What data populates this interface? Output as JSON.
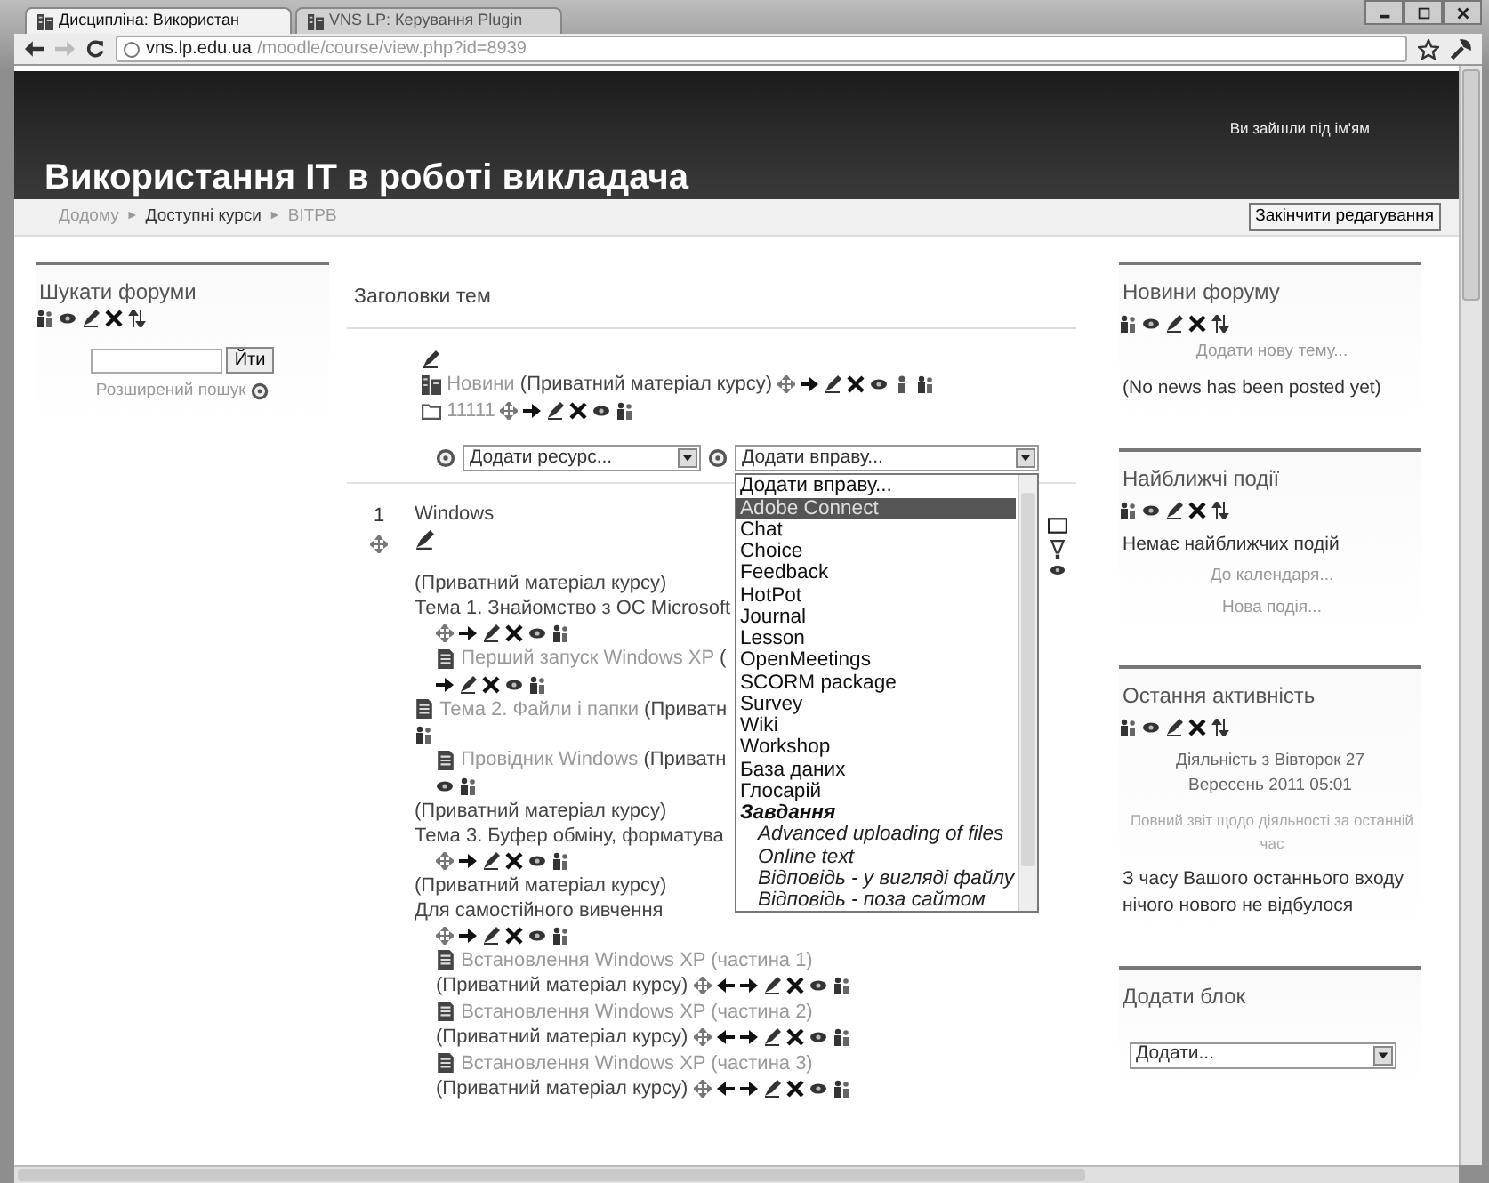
{
  "browser": {
    "tabs": [
      {
        "label": "Дисципліна: Використан",
        "selected": true
      },
      {
        "label": "VNS LP: Керування Plugin",
        "selected": false
      }
    ],
    "url_host": "vns.lp.edu.ua",
    "url_path": "/moodle/course/view.php?id=8939"
  },
  "header": {
    "title": "Використання ІТ в роботі викладача",
    "login": "Ви зайшли під ім'ям"
  },
  "breadcrumb": {
    "items": [
      "Додому",
      "Доступні курси",
      "ВІТРВ"
    ],
    "separators": [
      "►",
      "►"
    ]
  },
  "edit_button": "Закінчити редагування",
  "left_block": {
    "title": "Шукати форуми",
    "tools": {
      "kind": "block"
    },
    "search_button": "Йти",
    "advanced": "Розширений пошук"
  },
  "center": {
    "title": "Заголовки тем",
    "section0": [
      {
        "kind": "tools",
        "tools": {
          "kind": "edit-only"
        },
        "indented": false
      },
      {
        "kind": "forum",
        "link": "Новини",
        "note": "(Приватний матеріал курсу)",
        "tools": {
          "kind": "news"
        },
        "indented": false
      },
      {
        "kind": "folder",
        "link": "11111",
        "tools": {
          "kind": "activity"
        },
        "indented": false
      }
    ],
    "add_resource": "Додати ресурс...",
    "add_activity": "Додати вправу...",
    "activity_menu": [
      {
        "label": "Додати вправу...",
        "kind": "option",
        "selected": false
      },
      {
        "label": "Adobe Connect",
        "kind": "option",
        "selected": true
      },
      {
        "label": "Chat",
        "kind": "option",
        "selected": false
      },
      {
        "label": "Choice",
        "kind": "option",
        "selected": false
      },
      {
        "label": "Feedback",
        "kind": "option",
        "selected": false
      },
      {
        "label": "HotPot",
        "kind": "option",
        "selected": false
      },
      {
        "label": "Journal",
        "kind": "option",
        "selected": false
      },
      {
        "label": "Lesson",
        "kind": "option",
        "selected": false
      },
      {
        "label": "OpenMeetings",
        "kind": "option",
        "selected": false
      },
      {
        "label": "SCORM package",
        "kind": "option",
        "selected": false
      },
      {
        "label": "Survey",
        "kind": "option",
        "selected": false
      },
      {
        "label": "Wiki",
        "kind": "option",
        "selected": false
      },
      {
        "label": "Workshop",
        "kind": "option",
        "selected": false
      },
      {
        "label": "База даних",
        "kind": "option",
        "selected": false
      },
      {
        "label": "Глосарій",
        "kind": "option",
        "selected": false
      },
      {
        "label": "Завдання",
        "kind": "group",
        "selected": false
      },
      {
        "label": "Advanced uploading of files",
        "kind": "suboption",
        "selected": false
      },
      {
        "label": "Online text",
        "kind": "suboption",
        "selected": false
      },
      {
        "label": "Відповідь - у вигляді файлу",
        "kind": "suboption",
        "selected": false
      },
      {
        "label": "Відповідь - поза сайтом",
        "kind": "suboption",
        "selected": false
      }
    ],
    "sections": [
      {
        "number": "1",
        "title": "Windows",
        "lines": [
          {
            "kind": "text",
            "text": "(Приватний матеріал курсу)",
            "indented": false
          },
          {
            "kind": "text",
            "text": "Тема 1. Знайомство з ОС Microsoft",
            "indented": false
          },
          {
            "kind": "tools",
            "tools": {
              "kind": "activity"
            },
            "indented": true
          },
          {
            "kind": "resource",
            "link": "Перший запуск Windows XP",
            "note": "(",
            "indented": true
          },
          {
            "kind": "tools",
            "tools": {
              "kind": "indented"
            },
            "indented": true
          },
          {
            "kind": "resource",
            "link": "Тема 2. Файли і папки",
            "note": "(Приватн",
            "indented": false
          },
          {
            "kind": "tools",
            "tools": {
              "kind": "group-only"
            },
            "indented": false
          },
          {
            "kind": "resource",
            "link": "Провідник Windows",
            "note": "(Приватн",
            "indented": true
          },
          {
            "kind": "tools",
            "tools": {
              "kind": "eye-group"
            },
            "indented": true
          },
          {
            "kind": "text",
            "text": "(Приватний матеріал курсу)",
            "indented": false
          },
          {
            "kind": "text",
            "text": "Тема 3. Буфер обміну, форматува",
            "indented": false
          },
          {
            "kind": "tools",
            "tools": {
              "kind": "activity"
            },
            "indented": true
          },
          {
            "kind": "text",
            "text": "(Приватний матеріал курсу)",
            "indented": false
          },
          {
            "kind": "text",
            "text": "Для самостійного вивчення",
            "indented": false
          },
          {
            "kind": "tools",
            "tools": {
              "kind": "activity"
            },
            "indented": true
          },
          {
            "kind": "resource",
            "link": "Встановлення Windows XP (частина 1)",
            "note": "(Приватний матеріал курсу)",
            "tools": {
              "kind": "activity-lr"
            },
            "indented": true
          },
          {
            "kind": "resource",
            "link": "Встановлення Windows XP (частина 2)",
            "note": "(Приватний матеріал курсу)",
            "tools": {
              "kind": "activity-lr"
            },
            "indented": true
          },
          {
            "kind": "resource",
            "link": "Встановлення Windows XP (частина 3)",
            "note": "(Приватний матеріал курсу)",
            "tools": {
              "kind": "activity-lr"
            },
            "indented": true
          }
        ]
      }
    ]
  },
  "right_blocks": [
    {
      "title": "Новини форуму",
      "tools": {
        "kind": "block"
      },
      "items": [
        {
          "kind": "link",
          "text": "Додати нову тему..."
        },
        {
          "kind": "text",
          "text": "(No news has been posted yet)"
        }
      ]
    },
    {
      "title": "Найближчі події",
      "tools": {
        "kind": "block"
      },
      "items": [
        {
          "kind": "text",
          "text": "Немає найближчих подій"
        },
        {
          "kind": "link",
          "text": "До календаря..."
        },
        {
          "kind": "link",
          "text": "Нова подія..."
        }
      ]
    },
    {
      "title": "Остання активність",
      "tools": {
        "kind": "block"
      },
      "items": [
        {
          "kind": "center",
          "text": "Діяльність з Вівторок 27 Вересень 2011 05:01"
        },
        {
          "kind": "small-link",
          "text": "Повний звіт щодо діяльності за останній час"
        },
        {
          "kind": "text",
          "text": "З часу Вашого останнього входу нічого нового не відбулося"
        }
      ]
    }
  ],
  "add_block": {
    "title": "Додати блок",
    "select": "Додати..."
  }
}
